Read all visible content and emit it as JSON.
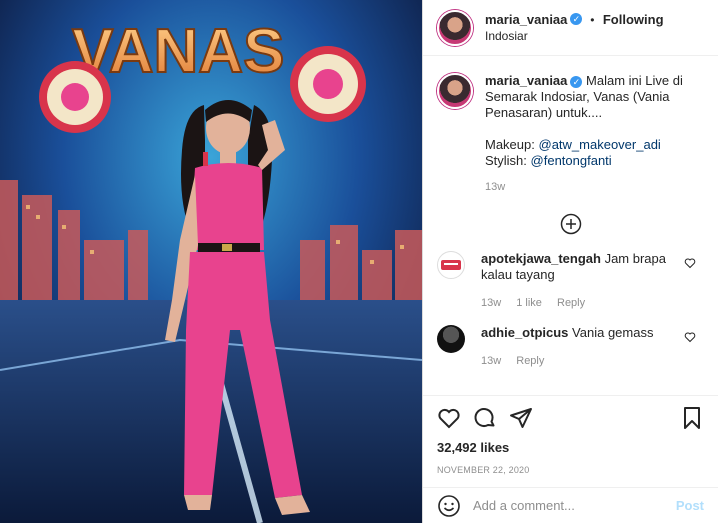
{
  "header": {
    "username": "maria_vaniaa",
    "follow_label": "Following",
    "location": "Indosiar"
  },
  "photo": {
    "sign_text": "VANAS"
  },
  "caption": {
    "username": "maria_vaniaa",
    "text": "Malam ini Live di Semarak Indosiar, Vanas (Vania Penasaran) untuk....",
    "makeup_label": "Makeup:",
    "makeup_mention": "@atw_makeover_adi",
    "stylish_label": "Stylish:",
    "stylish_mention": "@fentongfanti",
    "time": "13w"
  },
  "comments": [
    {
      "username": "apotekjawa_tengah",
      "text": "Jam brapa kalau tayang",
      "time": "13w",
      "likes": "1 like",
      "reply": "Reply"
    },
    {
      "username": "adhie_otpicus",
      "text": "Vania gemass",
      "time": "13w",
      "reply": "Reply"
    }
  ],
  "post": {
    "likes": "32,492 likes",
    "date": "NOVEMBER 22, 2020"
  },
  "add_comment": {
    "placeholder": "Add a comment...",
    "post_label": "Post"
  },
  "colors": {
    "accent": "#3897f0",
    "pink_outfit": "#e8438e",
    "post_disabled": "#b2dffc"
  }
}
